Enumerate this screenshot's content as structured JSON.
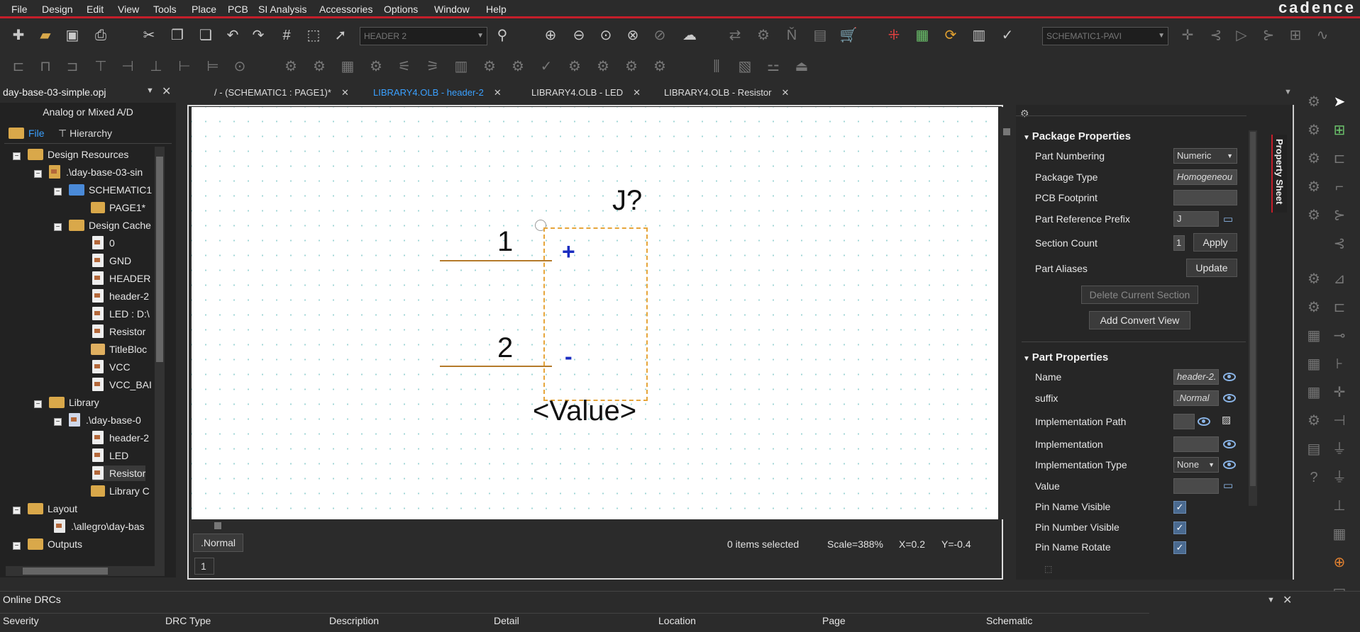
{
  "menubar": {
    "items": [
      "File",
      "Design",
      "Edit",
      "View",
      "Tools",
      "Place",
      "PCB",
      "SI Analysis",
      "Accessories",
      "Options",
      "Window",
      "Help"
    ],
    "logo": "cadence"
  },
  "toolbar": {
    "part_combo": "HEADER 2",
    "schematic_combo": "SCHEMATIC1-PAVI"
  },
  "project": {
    "title": "day-base-03-simple.opj",
    "mode": "Analog or Mixed A/D",
    "tabs": [
      "File",
      "Hierarchy"
    ]
  },
  "tabs": [
    {
      "label": "/ - (SCHEMATIC1 : PAGE1)*",
      "active": false
    },
    {
      "label": "LIBRARY4.OLB - header-2",
      "active": true
    },
    {
      "label": "LIBRARY4.OLB - LED",
      "active": false
    },
    {
      "label": "LIBRARY4.OLB - Resistor",
      "active": false
    }
  ],
  "tree": [
    {
      "label": "Design Resources",
      "type": "folder",
      "expand": "−"
    },
    {
      "label": ".\\day-base-03-sin",
      "type": "file",
      "expand": "−"
    },
    {
      "label": "SCHEMATIC1",
      "type": "schem",
      "expand": "−"
    },
    {
      "label": "PAGE1*",
      "type": "page",
      "expand": ""
    },
    {
      "label": "Design Cache",
      "type": "folder",
      "expand": "−"
    },
    {
      "label": "0",
      "type": "doc",
      "expand": ""
    },
    {
      "label": "GND",
      "type": "doc",
      "expand": ""
    },
    {
      "label": "HEADER",
      "type": "doc",
      "expand": ""
    },
    {
      "label": "header-2",
      "type": "doc",
      "expand": ""
    },
    {
      "label": "LED : D:\\",
      "type": "doc",
      "expand": ""
    },
    {
      "label": "Resistor",
      "type": "doc",
      "expand": ""
    },
    {
      "label": "TitleBloc",
      "type": "doc",
      "expand": ""
    },
    {
      "label": "VCC",
      "type": "doc",
      "expand": ""
    },
    {
      "label": "VCC_BAI",
      "type": "doc",
      "expand": ""
    },
    {
      "label": "Library",
      "type": "folder",
      "expand": "−"
    },
    {
      "label": ".\\day-base-0",
      "type": "file",
      "expand": "−"
    },
    {
      "label": "header-2",
      "type": "doc",
      "expand": ""
    },
    {
      "label": "LED",
      "type": "doc",
      "expand": ""
    },
    {
      "label": "Resistor",
      "type": "doc",
      "expand": ""
    },
    {
      "label": "Library C",
      "type": "folder",
      "expand": ""
    },
    {
      "label": "Layout",
      "type": "folder",
      "expand": "−"
    },
    {
      "label": ".\\allegro\\day-bas",
      "type": "file",
      "expand": ""
    },
    {
      "label": "Outputs",
      "type": "folder",
      "expand": "−"
    }
  ],
  "schematic": {
    "refdes": "J?",
    "value": "<Value>",
    "pin1": "1",
    "pin2": "2",
    "plus": "+",
    "minus": "-"
  },
  "status": {
    "view": ".Normal",
    "page": "1",
    "selected": "0 items selected",
    "scale": "Scale=388%",
    "x": "X=0.2",
    "y": "Y=-0.4"
  },
  "properties": {
    "package_title": "Package Properties",
    "part_title": "Part Properties",
    "sheet_tab": "Property Sheet",
    "part_numbering": {
      "label": "Part Numbering",
      "value": "Numeric"
    },
    "package_type": {
      "label": "Package Type",
      "value": "Homogeneou"
    },
    "pcb_footprint": {
      "label": "PCB Footprint",
      "value": ""
    },
    "ref_prefix": {
      "label": "Part Reference Prefix",
      "value": "J"
    },
    "section_count": {
      "label": "Section Count",
      "value": "1",
      "button": "Apply"
    },
    "aliases": {
      "label": "Part Aliases",
      "button": "Update"
    },
    "delete_section": "Delete Current Section",
    "add_convert": "Add Convert View",
    "name": {
      "label": "Name",
      "value": "header-2."
    },
    "suffix": {
      "label": "suffix",
      "value": ".Normal"
    },
    "impl_path": {
      "label": "Implementation Path",
      "value": ""
    },
    "implementation": {
      "label": "Implementation",
      "value": ""
    },
    "impl_type": {
      "label": "Implementation Type",
      "value": "None"
    },
    "value_prop": {
      "label": "Value",
      "value": ""
    },
    "pin_name_visible": {
      "label": "Pin Name Visible",
      "checked": true
    },
    "pin_number_visible": {
      "label": "Pin Number Visible",
      "checked": true
    },
    "pin_name_rotate": {
      "label": "Pin Name Rotate",
      "checked": true
    }
  },
  "drc": {
    "title": "Online DRCs",
    "columns": [
      "Severity",
      "DRC Type",
      "Description",
      "Detail",
      "Location",
      "Page",
      "Schematic"
    ]
  }
}
